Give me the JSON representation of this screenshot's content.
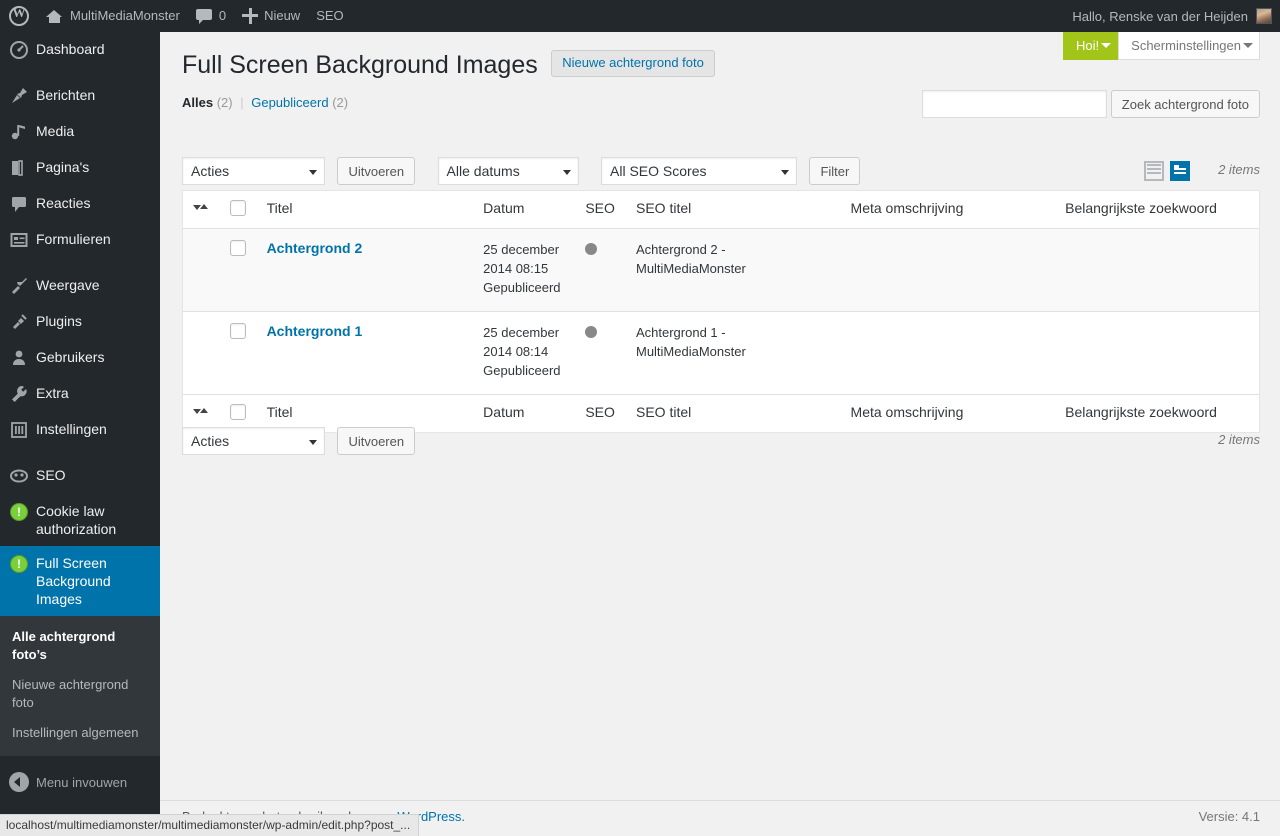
{
  "adminbar": {
    "wp_logo": "wordpress-logo",
    "site_name": "MultiMediaMonster",
    "comments_count": "0",
    "new_label": "Nieuw",
    "seo_label": "SEO",
    "greeting": "Hallo, Renske van der Heijden"
  },
  "sidebar": {
    "items": [
      {
        "label": "Dashboard",
        "icon": "dashboard-icon"
      },
      {
        "label": "Berichten",
        "icon": "pin-icon"
      },
      {
        "label": "Media",
        "icon": "media-icon"
      },
      {
        "label": "Pagina's",
        "icon": "pages-icon"
      },
      {
        "label": "Reacties",
        "icon": "comment-icon"
      },
      {
        "label": "Formulieren",
        "icon": "forms-icon"
      },
      {
        "label": "Weergave",
        "icon": "appearance-icon"
      },
      {
        "label": "Plugins",
        "icon": "plugins-icon"
      },
      {
        "label": "Gebruikers",
        "icon": "users-icon"
      },
      {
        "label": "Extra",
        "icon": "tools-icon"
      },
      {
        "label": "Instellingen",
        "icon": "settings-icon"
      },
      {
        "label": "SEO",
        "icon": "seo-icon"
      },
      {
        "label": "Cookie law authorization",
        "icon": "info-circle-icon"
      },
      {
        "label": "Full Screen Background Images",
        "icon": "info-circle-icon"
      }
    ],
    "submenu": [
      {
        "label": "Alle achtergrond foto’s",
        "active": true
      },
      {
        "label": "Nieuwe achtergrond foto",
        "active": false
      },
      {
        "label": "Instellingen algemeen",
        "active": false
      }
    ],
    "collapse_label": "Menu invouwen"
  },
  "screen_meta": {
    "help_label": "Hoi!",
    "options_label": "Scherminstellingen",
    "accent_green": "#a3c519"
  },
  "page": {
    "title": "Full Screen Background Images",
    "add_new_label": "Nieuwe achtergrond foto"
  },
  "subsubsub": {
    "all_label": "Alles",
    "all_count": "(2)",
    "separator": "|",
    "published_label": "Gepubliceerd",
    "published_count": "(2)"
  },
  "search": {
    "value": "",
    "placeholder": "",
    "button_label": "Zoek achtergrond foto"
  },
  "tablenav_top": {
    "bulk_action": "Acties",
    "apply_label": "Uitvoeren",
    "date_filter": "Alle datums",
    "seo_filter": "All SEO Scores",
    "filter_label": "Filter",
    "view_list_icon": "list-view-icon",
    "view_excerpt_icon": "excerpt-view-icon",
    "items_count": "2 items"
  },
  "tablenav_bottom": {
    "bulk_action": "Acties",
    "apply_label": "Uitvoeren",
    "items_count": "2 items"
  },
  "table": {
    "columns": [
      "Titel",
      "Datum",
      "SEO",
      "SEO titel",
      "Meta omschrijving",
      "Belangrijkste zoekwoord"
    ],
    "rows": [
      {
        "title": "Achtergrond 2",
        "date_line1": "25 december",
        "date_line2": "2014 08:15",
        "date_status": "Gepubliceerd",
        "seo_dot_color": "#888888",
        "seo_title_line1": "Achtergrond 2 -",
        "seo_title_line2": "MultiMediaMonster",
        "meta_description": "",
        "focus_keyword": ""
      },
      {
        "title": "Achtergrond 1",
        "date_line1": "25 december",
        "date_line2": "2014 08:14",
        "date_status": "Gepubliceerd",
        "seo_dot_color": "#888888",
        "seo_title_line1": "Achtergrond 1 -",
        "seo_title_line2": "MultiMediaMonster",
        "meta_description": "",
        "focus_keyword": ""
      }
    ]
  },
  "footer": {
    "thanks_text": "Bedankt voor het gebruik maken van ",
    "wordpress_link": "WordPress.",
    "version": "Versie: 4.1"
  },
  "statusbar": {
    "url": "localhost/multimediamonster/multimediamonster/wp-admin/edit.php?post_..."
  }
}
